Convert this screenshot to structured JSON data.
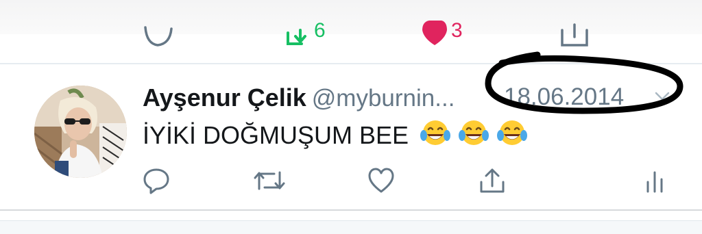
{
  "previous_tweet": {
    "retweet_count": "6",
    "like_count": "3",
    "colors": {
      "retweet": "#17bf63",
      "like": "#e0245e"
    },
    "icons": [
      "reply-icon",
      "retweet-icon",
      "heart-filled-icon",
      "share-icon"
    ]
  },
  "tweet": {
    "display_name": "Ayşenur Çelik",
    "handle": "@myburnin...",
    "date": "18.06.2014",
    "text": "İYİKİ DOĞMUŞUM BEE",
    "emoji_names": [
      "face-with-tears-of-joy",
      "face-with-tears-of-joy",
      "face-with-tears-of-joy"
    ],
    "action_icons": [
      "reply-icon",
      "retweet-icon",
      "like-icon",
      "share-icon",
      "analytics-icon"
    ],
    "colors": {
      "action_gray": "#657786",
      "text": "#14171a",
      "muted": "#657786"
    }
  },
  "annotation": {
    "type": "hand-drawn-ellipse",
    "color": "#000000"
  }
}
